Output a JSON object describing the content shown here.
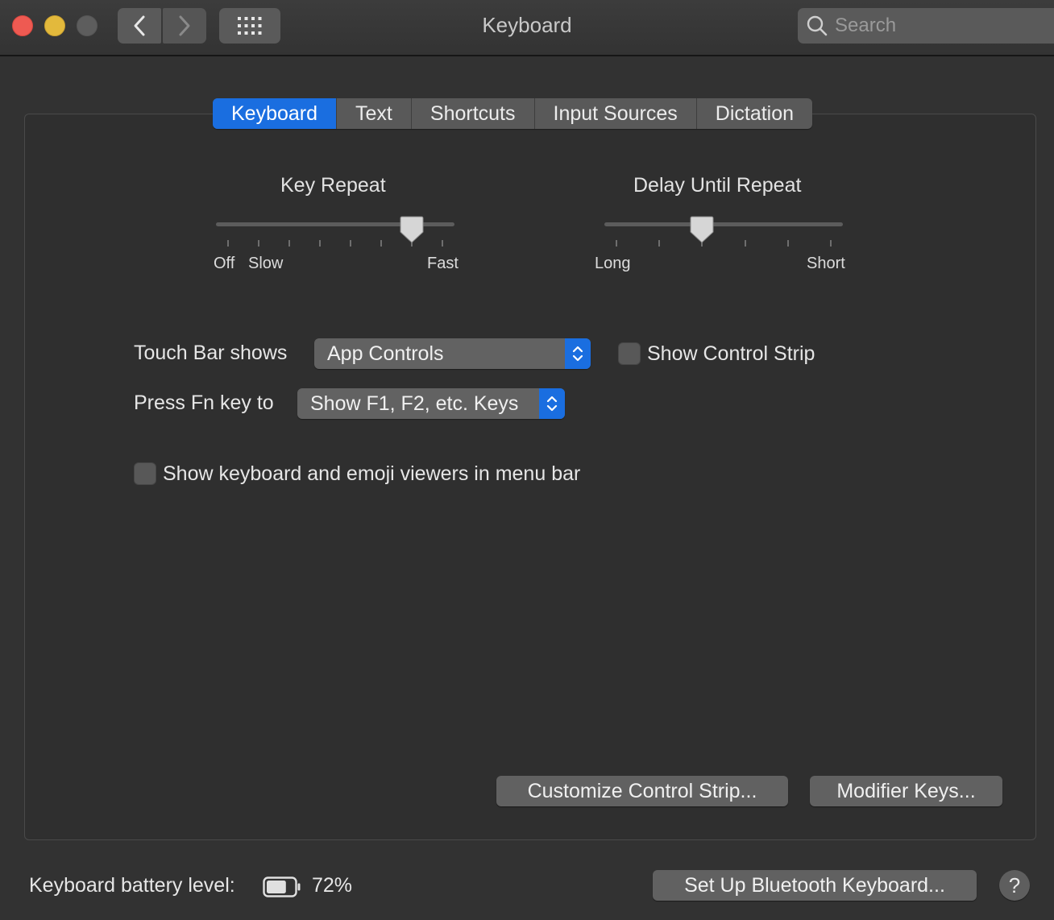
{
  "window": {
    "title": "Keyboard"
  },
  "search": {
    "placeholder": "Search"
  },
  "tabs": [
    {
      "label": "Keyboard",
      "active": true
    },
    {
      "label": "Text",
      "active": false
    },
    {
      "label": "Shortcuts",
      "active": false
    },
    {
      "label": "Input Sources",
      "active": false
    },
    {
      "label": "Dictation",
      "active": false
    }
  ],
  "key_repeat": {
    "title": "Key Repeat",
    "labels": {
      "off": "Off",
      "slow": "Slow",
      "fast": "Fast"
    },
    "tick_count": 8,
    "selected_tick": 6
  },
  "delay_until_repeat": {
    "title": "Delay Until Repeat",
    "labels": {
      "long": "Long",
      "short": "Short"
    },
    "tick_count": 6,
    "selected_tick": 2
  },
  "touch_bar": {
    "label": "Touch Bar shows",
    "value": "App Controls",
    "show_control_strip_label": "Show Control Strip",
    "show_control_strip_checked": false
  },
  "fn_key": {
    "label": "Press Fn key to",
    "value": "Show F1, F2, etc. Keys"
  },
  "viewers": {
    "label": "Show keyboard and emoji viewers in menu bar",
    "checked": false
  },
  "buttons": {
    "customize": "Customize Control Strip...",
    "modifier": "Modifier Keys...",
    "bluetooth": "Set Up Bluetooth Keyboard...",
    "help": "?"
  },
  "battery": {
    "label": "Keyboard battery level:",
    "percent_text": "72%",
    "level": 0.72
  },
  "colors": {
    "accent": "#1a6ee0"
  }
}
